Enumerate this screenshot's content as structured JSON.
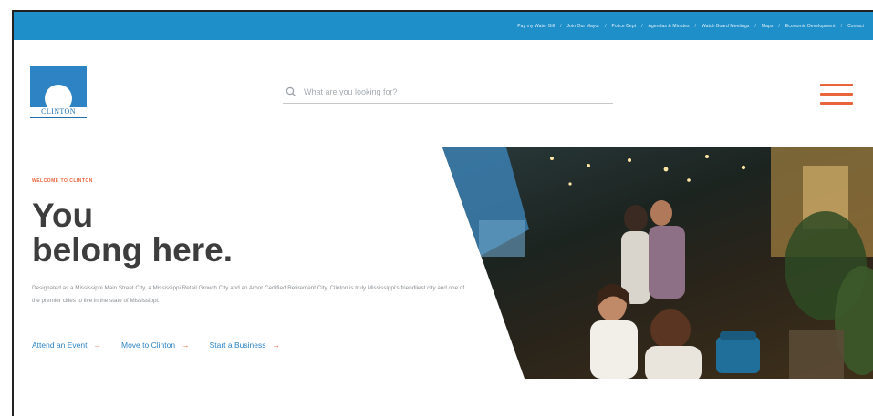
{
  "utility_nav": [
    "Pay my Water Bill",
    "Join Our Mayor",
    "Police Dept",
    "Agendas & Minutes",
    "Watch Board Meetings",
    "Maps",
    "Economic Development",
    "Contact"
  ],
  "logo": {
    "text": "CLINTON"
  },
  "search": {
    "placeholder": "What are you looking for?",
    "icon": "search-icon"
  },
  "menu": {
    "icon": "hamburger-menu-icon"
  },
  "hero": {
    "kicker": "WELCOME TO CLINTON",
    "headline_line1": "You",
    "headline_line2": "belong here.",
    "intro": "Designated as a Mississippi Main Street City, a Mississippi Retail Growth City and an Arbor Certified Retirement City, Clinton is truly Mississippi's friendliest city and one of the premier cities to live in the state of Mississippi.",
    "ctas": [
      "Attend an Event",
      "Move to Clinton",
      "Start a Business"
    ],
    "cta_arrow": "→"
  },
  "colors": {
    "brand_blue": "#1f8fc9",
    "accent_orange": "#e8643b",
    "text_dark": "#3d3d3d"
  }
}
